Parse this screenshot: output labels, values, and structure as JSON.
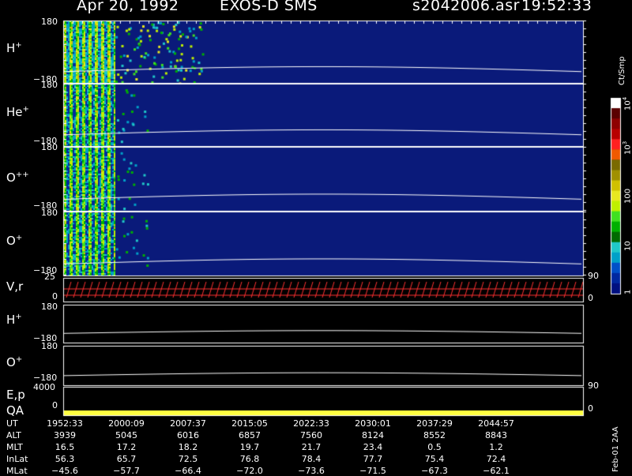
{
  "header": {
    "date": "Apr 20, 1992",
    "instrument": "EXOS-D SMS",
    "filename": "s2042006.asr",
    "time": "19:52:33"
  },
  "colorbar": {
    "title": "Ct/Smp",
    "ticks": [
      {
        "base": "1",
        "exp": ""
      },
      {
        "base": "10",
        "exp": ""
      },
      {
        "base": "100",
        "exp": ""
      },
      {
        "base": "10",
        "exp": "3"
      },
      {
        "base": "10",
        "exp": "4"
      }
    ],
    "colors": [
      "#ffffff",
      "#5a0000",
      "#8e0000",
      "#b80000",
      "#ff2020",
      "#f05a00",
      "#7a6a00",
      "#a09000",
      "#d0c000",
      "#e8e820",
      "#bff000",
      "#40e020",
      "#00b000",
      "#006a00",
      "#20c8c8",
      "#00a0c8",
      "#0050c8",
      "#0028a0",
      "#001080"
    ]
  },
  "panels": {
    "spectrograms": [
      {
        "base": "H",
        "sup": "+",
        "tick_top": "180",
        "tick_bottom": "−180"
      },
      {
        "base": "He",
        "sup": "+",
        "tick_top": "180",
        "tick_bottom": "−180"
      },
      {
        "base": "O",
        "sup": "++",
        "tick_top": "180",
        "tick_bottom": "−180"
      },
      {
        "base": "O",
        "sup": "+",
        "tick_top": "180",
        "tick_bottom": "−180"
      }
    ],
    "vr": {
      "label": "V,r",
      "tick_left_top": "25",
      "tick_left_bottom": "0",
      "tick_right_top": "90",
      "tick_right_bottom": "0"
    },
    "lines": [
      {
        "base": "H",
        "sup": "+",
        "tick_top": "180",
        "tick_bottom": "−180"
      },
      {
        "base": "O",
        "sup": "+",
        "tick_top": "180",
        "tick_bottom": "−180"
      }
    ],
    "ep": {
      "label": "E,p",
      "tick_left": "4000",
      "tick_right": "90"
    },
    "qa": {
      "label": "QA",
      "tick_left": "0",
      "tick_right": "0"
    }
  },
  "footer_note": "Feb-01 2AA",
  "table": {
    "rows": [
      {
        "name": "UT",
        "values": [
          "1952:33",
          "2000:09",
          "2007:37",
          "2015:05",
          "2022:33",
          "2030:01",
          "2037:29",
          "2044:57"
        ]
      },
      {
        "name": "ALT",
        "values": [
          "3939",
          "5045",
          "6016",
          "6857",
          "7560",
          "8124",
          "8552",
          "8843"
        ]
      },
      {
        "name": "MLT",
        "values": [
          "16.5",
          "17.2",
          "18.2",
          "19.7",
          "21.7",
          "23.4",
          "0.5",
          "1.2"
        ]
      },
      {
        "name": "InLat",
        "values": [
          "56.3",
          "65.7",
          "72.5",
          "76.8",
          "78.4",
          "77.7",
          "75.4",
          "72.4"
        ]
      },
      {
        "name": "MLat",
        "values": [
          "−45.6",
          "−57.7",
          "−66.4",
          "−72.0",
          "−73.6",
          "−71.5",
          "−67.3",
          "−62.1"
        ]
      }
    ]
  },
  "chart_data": {
    "type": "heatmap",
    "title": "Apr 20, 1992 EXOS-D SMS",
    "x_ticks_ut": [
      "1952:33",
      "2000:09",
      "2007:37",
      "2015:05",
      "2022:33",
      "2030:01",
      "2037:29",
      "2044:57"
    ],
    "pitch_angle_range": [
      -180,
      180
    ],
    "species": [
      "H+",
      "He+",
      "O++",
      "O+"
    ],
    "color_scale": {
      "type": "log",
      "range": [
        1,
        10000
      ],
      "unit": "Ct/Smp"
    },
    "vr_range": [
      0,
      25
    ],
    "ep_range": [
      0,
      4000
    ]
  }
}
